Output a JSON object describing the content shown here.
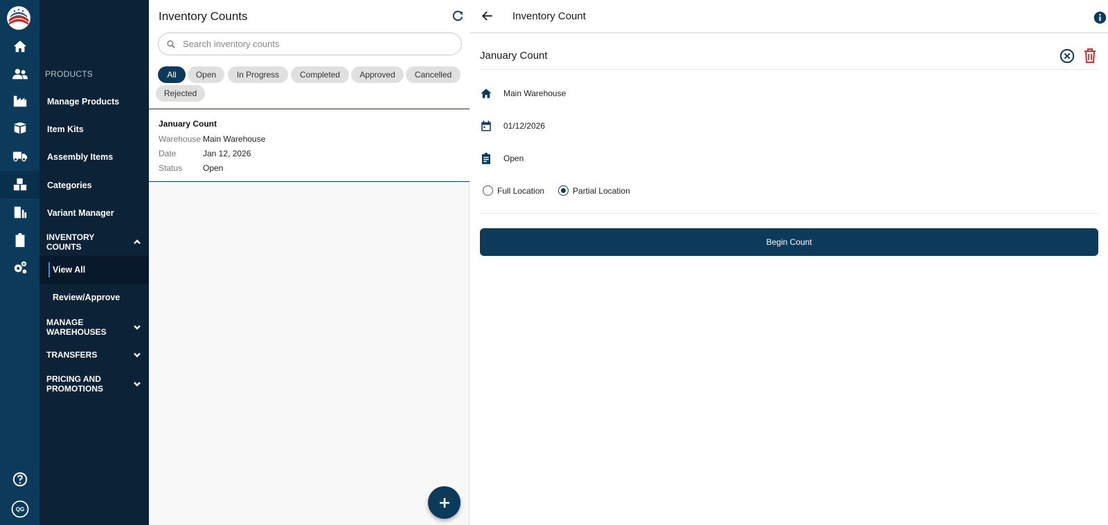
{
  "rail": {
    "items": [
      {
        "icon": "home-icon"
      },
      {
        "icon": "users-icon"
      },
      {
        "icon": "factory-icon"
      },
      {
        "icon": "box-icon"
      },
      {
        "icon": "truck-icon"
      },
      {
        "icon": "boxes-icon"
      },
      {
        "icon": "report-icon"
      },
      {
        "icon": "clipboard-icon"
      },
      {
        "icon": "settings-icon"
      }
    ],
    "avatar_initials": "QG"
  },
  "nav": {
    "section": "PRODUCTS",
    "items": [
      {
        "label": "Manage Products"
      },
      {
        "label": "Item Kits"
      },
      {
        "label": "Assembly Items"
      },
      {
        "label": "Categories"
      },
      {
        "label": "Variant Manager"
      }
    ],
    "inventory_group": "INVENTORY COUNTS",
    "inventory_sub": [
      {
        "label": "View All"
      },
      {
        "label": "Review/Approve"
      }
    ],
    "groups": [
      {
        "label": "MANAGE WAREHOUSES"
      },
      {
        "label": "TRANSFERS"
      },
      {
        "label": "PRICING AND PROMOTIONS"
      }
    ]
  },
  "list": {
    "title": "Inventory Counts",
    "search_placeholder": "Search inventory counts",
    "filters": [
      "All",
      "Open",
      "In Progress",
      "Completed",
      "Approved",
      "Cancelled",
      "Rejected"
    ],
    "selected_filter": "All",
    "card": {
      "title": "January Count",
      "fields": [
        {
          "k": "Warehouse",
          "v": "Main Warehouse"
        },
        {
          "k": "Date",
          "v": "Jan 12, 2026"
        },
        {
          "k": "Status",
          "v": "Open"
        }
      ]
    }
  },
  "detail": {
    "header_title": "Inventory Count",
    "record_title": "January Count",
    "warehouse": "Main Warehouse",
    "date": "01/12/2026",
    "status": "Open",
    "radio_full": "Full Location",
    "radio_partial": "Partial Location",
    "selected_scope": "Partial Location",
    "begin_label": "Begin Count"
  },
  "colors": {
    "primary": "#0c3a5b",
    "sidebar": "#0b2237",
    "danger": "#d32f2f"
  }
}
